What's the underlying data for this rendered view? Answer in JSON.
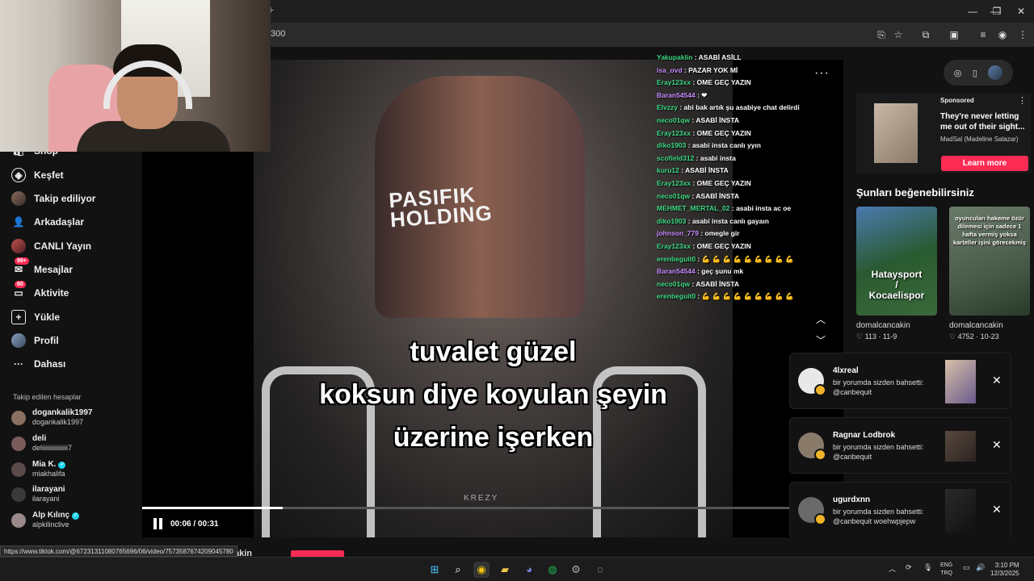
{
  "browser": {
    "url_fragment": "300",
    "status_url": "https://www.tiktok.com/@67231311080765696/06/video/7573587674209045780"
  },
  "sidebar": {
    "items": [
      {
        "label": "Shop",
        "icon": "shop-icon"
      },
      {
        "label": "Keşfet",
        "icon": "compass-icon"
      },
      {
        "label": "Takip ediliyor",
        "icon": "avatar"
      },
      {
        "label": "Arkadaşlar",
        "icon": "friends-icon"
      },
      {
        "label": "CANLI Yayın",
        "icon": "live-icon"
      },
      {
        "label": "Mesajlar",
        "icon": "message-icon",
        "badge": "99+"
      },
      {
        "label": "Aktivite",
        "icon": "inbox-icon",
        "badge": "60"
      },
      {
        "label": "Yükle",
        "icon": "upload-icon"
      },
      {
        "label": "Profil",
        "icon": "profile-avatar"
      },
      {
        "label": "Dahası",
        "icon": "more-icon"
      }
    ],
    "following_title": "Takip edilen hesaplar",
    "accounts": [
      {
        "name": "dogankalik1997",
        "handle": "dogankalik1997",
        "verified": false
      },
      {
        "name": "deli",
        "handle": "deliiiiiiiiiiiiiiii7",
        "verified": false
      },
      {
        "name": "Mia K.",
        "handle": "miakhalifa",
        "verified": true
      },
      {
        "name": "ilarayani",
        "handle": "ilarayani",
        "verified": false
      },
      {
        "name": "Alp Kılınç",
        "handle": "alpkilinclive",
        "verified": true
      }
    ],
    "cut_label": "akin"
  },
  "video": {
    "jersey_text": "PASIFIK\nHOLDING",
    "caption_lines": [
      "tuvalet güzel",
      "koksun diye koyulan şeyin",
      "üzerine işerken"
    ],
    "watermark": "KREZY",
    "time": "00:06 / 00:31",
    "progress": 0.2
  },
  "chat": [
    {
      "user": "Yakupaklin",
      "msg": " : ASABİ ASİLL",
      "purple": false
    },
    {
      "user": "isa_ovd",
      "msg": " : PAZAR YOK Mİ",
      "purple": true
    },
    {
      "user": "Eray123xx",
      "msg": " : OME GEÇ YAZIN",
      "purple": false
    },
    {
      "user": "Baran54544",
      "msg": " : ❤",
      "purple": true
    },
    {
      "user": "Elvzzy",
      "msg": " : abi bak artık şu asabiye chat delirdi",
      "purple": false
    },
    {
      "user": "neco01qw",
      "msg": " : ASABİ İNSTA",
      "purple": false
    },
    {
      "user": "Eray123xx",
      "msg": " : OME GEÇ YAZIN",
      "purple": false
    },
    {
      "user": "diko1903",
      "msg": " : asabi insta canlı yyın",
      "purple": false
    },
    {
      "user": "scofield312",
      "msg": " : asabi insta",
      "purple": false
    },
    {
      "user": "kuru12",
      "msg": " : ASABİ İNSTA",
      "purple": false
    },
    {
      "user": "Eray123xx",
      "msg": " : OME GEÇ YAZIN",
      "purple": false
    },
    {
      "user": "neco01qw",
      "msg": " : ASABİ İNSTA",
      "purple": false
    },
    {
      "user": "MEHMET_MERTAL_02",
      "msg": " : asabi insta ac oe",
      "purple": false
    },
    {
      "user": "diko1903",
      "msg": " : asabi insta canlı gayaın",
      "purple": false
    },
    {
      "user": "johnson_779",
      "msg": " : omegle gir",
      "purple": true
    },
    {
      "user": "Eray123xx",
      "msg": " : OME GEÇ YAZIN",
      "purple": false
    },
    {
      "user": "erenbeguit0",
      "msg": " : 💪 💪 💪 💪 💪 💪 💪 💪 💪",
      "purple": false
    },
    {
      "user": "Baran54544",
      "msg": " : geç şunu mk",
      "purple": true
    },
    {
      "user": "neco01qw",
      "msg": " : ASABİ İNSTA",
      "purple": false
    },
    {
      "user": "erenbeguit0",
      "msg": " : 💪 💪 💪 💪 💪 💪 💪 💪 💪",
      "purple": false
    }
  ],
  "ad": {
    "sponsored": "Sponsored",
    "title": "They're never letting me out of their sight...",
    "by": "MadSal (Madeline Salazar)",
    "button": "Learn more"
  },
  "recommend": {
    "title": "Şunları beğenebilirsiniz",
    "items": [
      {
        "overlay": "Hataysport\n/\nKocaelispor",
        "author": "domalcancakin",
        "stats": "♡ 113 · 11-9"
      },
      {
        "overlay": "oyuncuları hakeme özür dilemesi için sadece 1 hafta vermiş yoksa karteller işini görecekmiş",
        "author": "domalcancakin",
        "stats": "♡ 4752 · 10-23"
      }
    ]
  },
  "notifications": [
    {
      "name": "4lxreal",
      "line1": "bir yorumda sizden bahsetti:",
      "line2": "@canbequit"
    },
    {
      "name": "Ragnar Lodbrok",
      "line1": "bir yorumda sizden bahsetti:",
      "line2": "@canbequit"
    },
    {
      "name": "ugurdxnn",
      "line1": "bir yorumda sizden bahsetti:",
      "line2": "@canbequit woehwpjepw"
    }
  ],
  "taskbar": {
    "lang_top": "ENG",
    "lang_bottom": "TRQ",
    "time": "3:10 PM",
    "date": "12/3/2025"
  }
}
